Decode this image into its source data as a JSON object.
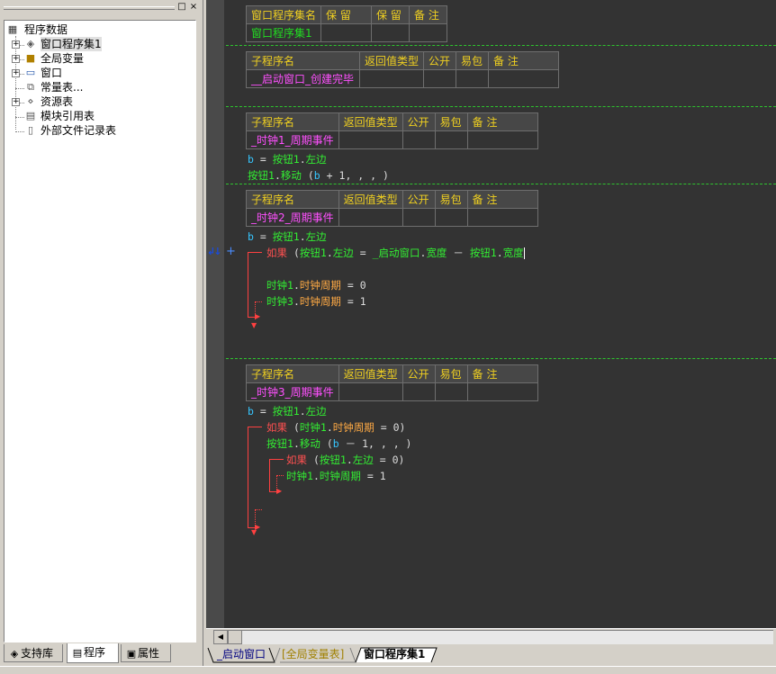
{
  "left_panel": {
    "title_buttons": [
      "□",
      "×"
    ],
    "tree": [
      {
        "label": "程序数据",
        "icon": "database-icon"
      },
      {
        "label": "窗口程序集1",
        "icon": "layers-icon"
      },
      {
        "label": "全局变量",
        "icon": "variable-jar-icon"
      },
      {
        "label": "窗口",
        "icon": "window-icon"
      },
      {
        "label": "常量表...",
        "icon": "constants-box-icon"
      },
      {
        "label": "资源表",
        "icon": "resource-icon"
      },
      {
        "label": "模块引用表",
        "icon": "module-doc-icon"
      },
      {
        "label": "外部文件记录表",
        "icon": "file-doc-icon"
      }
    ],
    "tabs": [
      "支持库",
      "程序",
      "属性"
    ],
    "active_tab": "程序"
  },
  "editor": {
    "assembly_table": {
      "headers": [
        "窗口程序集名",
        "保 留",
        "保 留",
        "备 注"
      ],
      "row": [
        "窗口程序集1",
        "",
        "",
        ""
      ]
    },
    "subs": [
      {
        "headers": [
          "子程序名",
          "返回值类型",
          "公开",
          "易包",
          "备 注"
        ],
        "name": "__启动窗口_创建完毕"
      },
      {
        "headers": [
          "子程序名",
          "返回值类型",
          "公开",
          "易包",
          "备 注"
        ],
        "name": "_时钟1_周期事件",
        "code": {
          "line1": [
            "b",
            "=",
            "按钮1",
            ".",
            "左边"
          ],
          "line2": [
            "按钮1",
            ".",
            "移动",
            "(",
            "b",
            "+",
            "1",
            ", , , )"
          ]
        }
      },
      {
        "headers": [
          "子程序名",
          "返回值类型",
          "公开",
          "易包",
          "备 注"
        ],
        "name": "_时钟2_周期事件",
        "code": {
          "line1": [
            "b",
            "=",
            "按钮1",
            ".",
            "左边"
          ],
          "if": [
            "如果",
            "(",
            "按钮1",
            ".",
            "左边",
            "=",
            "_启动窗口",
            ".",
            "宽度",
            "－",
            "按钮1",
            ".",
            "宽度"
          ],
          "body1": [
            "时钟1",
            ".",
            "时钟周期",
            "=",
            "0"
          ],
          "body2": [
            "时钟3",
            ".",
            "时钟周期",
            "=",
            "1"
          ]
        }
      },
      {
        "headers": [
          "子程序名",
          "返回值类型",
          "公开",
          "易包",
          "备 注"
        ],
        "name": "_时钟3_周期事件",
        "code": {
          "line1": [
            "b",
            "=",
            "按钮1",
            ".",
            "左边"
          ],
          "if1": [
            "如果",
            "(",
            "时钟1",
            ".",
            "时钟周期",
            "=",
            "0",
            ")"
          ],
          "move": [
            "按钮1",
            ".",
            "移动",
            "(",
            "b",
            "－",
            "1",
            ", , , )"
          ],
          "if2": [
            "如果",
            "(",
            "按钮1",
            ".",
            "左边",
            "=",
            "0",
            ")"
          ],
          "body": [
            "时钟1",
            ".",
            "时钟周期",
            "=",
            "1"
          ]
        }
      }
    ]
  },
  "doc_tabs": [
    "_启动窗口",
    "[全局变量表]",
    "窗口程序集1"
  ],
  "active_doc_tab": "窗口程序集1",
  "colors": {
    "editor_bg": "#333333",
    "header_text": "#f0d020",
    "name_text": "#ff50ff",
    "separator": "#2ec42e",
    "flow_line": "#ff4040"
  }
}
